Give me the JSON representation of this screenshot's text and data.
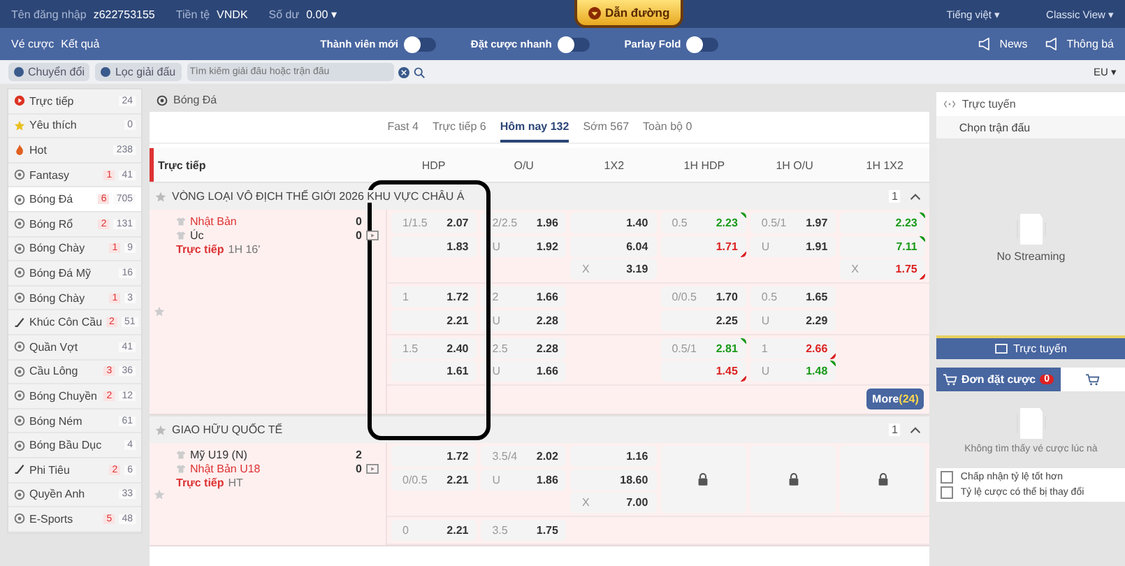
{
  "account": {
    "fields": [
      {
        "label": "Tên đăng nhập",
        "value": "z622753155"
      },
      {
        "label": "Tiền tệ",
        "value": "VNDK"
      },
      {
        "label": "Số dư",
        "value": "0.00 ▾"
      }
    ],
    "guide_tab": "Dẫn đường",
    "language": "Tiếng việt ▾",
    "view": "Classic View ▾"
  },
  "nav": {
    "links": [
      "Vé cược",
      "Kết quả"
    ],
    "toggles": [
      {
        "label": "Thành viên mới",
        "on": false
      },
      {
        "label": "Đặt cược nhanh",
        "on": false
      },
      {
        "label": "Parlay Fold",
        "on": false
      }
    ],
    "right_links": [
      "News",
      "Thông bá"
    ]
  },
  "filter_bar": {
    "buttons": [
      "Chuyển đổi",
      "Lọc giải đấu"
    ],
    "search": {
      "placeholder": "Tìm kiếm giải đấu hoặc trận đấu"
    },
    "odds_format": "EU ▾"
  },
  "sidebar": {
    "items": [
      {
        "kind": "live",
        "name": "Trực tiếp",
        "total": "24",
        "selected": false
      },
      {
        "kind": "star",
        "name": "Yêu thích",
        "total": "0",
        "selected": false
      },
      {
        "kind": "flame",
        "name": "Hot",
        "total": "238",
        "selected": false
      },
      {
        "kind": "ball",
        "name": "Fantasy",
        "live": "1",
        "total": "41",
        "selected": false
      },
      {
        "kind": "ball",
        "name": "Bóng Đá",
        "live": "6",
        "total": "705",
        "selected": true
      },
      {
        "kind": "ball",
        "name": "Bóng Rổ",
        "live": "2",
        "total": "131",
        "selected": false
      },
      {
        "kind": "ball",
        "name": "Bóng Chày",
        "live": "1",
        "total": "9",
        "selected": false
      },
      {
        "kind": "ball",
        "name": "Bóng Đá Mỹ",
        "total": "16",
        "selected": false
      },
      {
        "kind": "ball",
        "name": "Bóng Chày",
        "live": "1",
        "total": "3",
        "selected": false
      },
      {
        "kind": "stick",
        "name": "Khúc Côn Cầu",
        "live": "2",
        "total": "51",
        "selected": false
      },
      {
        "kind": "ball",
        "name": "Quần Vợt",
        "total": "41",
        "selected": false
      },
      {
        "kind": "ball",
        "name": "Cầu Lông",
        "live": "3",
        "total": "36",
        "selected": false
      },
      {
        "kind": "ball",
        "name": "Bóng Chuyền",
        "live": "2",
        "total": "12",
        "selected": false
      },
      {
        "kind": "ball",
        "name": "Bóng Ném",
        "total": "61",
        "selected": false
      },
      {
        "kind": "ball",
        "name": "Bóng Bầu Dục",
        "total": "4",
        "selected": false
      },
      {
        "kind": "stick",
        "name": "Phi Tiêu",
        "live": "2",
        "total": "6",
        "selected": false
      },
      {
        "kind": "ball",
        "name": "Quyền Anh",
        "total": "33",
        "selected": false
      },
      {
        "kind": "ball",
        "name": "E-Sports",
        "live": "5",
        "total": "48",
        "selected": false
      }
    ]
  },
  "main": {
    "title": "Bóng Đá",
    "tabs": [
      {
        "label": "Fast 4",
        "selected": false
      },
      {
        "label": "Trực tiếp 6",
        "selected": false
      },
      {
        "label": "Hôm nay 132",
        "selected": true
      },
      {
        "label": "Sớm 567",
        "selected": false
      },
      {
        "label": "Toàn bộ 0",
        "selected": false
      }
    ],
    "section": "Trực tiếp",
    "columns": [
      "HDP",
      "O/U",
      "1X2",
      "1H HDP",
      "1H O/U",
      "1H 1X2"
    ],
    "leagues": [
      {
        "name": "VÒNG LOẠI VÔ ĐỊCH THẾ GIỚI 2026 KHU VỰC CHÂU Á",
        "count": "1",
        "more": {
          "label": "More",
          "count": "(24)"
        },
        "matches": [
          {
            "home": "Nhật Bản",
            "away": "Úc",
            "home_favored": true,
            "home_score": "0",
            "away_score": "0",
            "status": "Trực tiếp",
            "time": "1H 16'",
            "groups": [
              [
                {
                  "kind": "odds",
                  "cells": [
                    {
                      "line": "1/1.5",
                      "value": "2.07",
                      "up": false,
                      "down": false
                    },
                    {
                      "value": "1.83",
                      "up": false,
                      "down": false
                    }
                  ]
                },
                {
                  "kind": "odds",
                  "cells": [
                    {
                      "line": "2/2.5",
                      "value": "1.96",
                      "up": false,
                      "down": false
                    },
                    {
                      "line": "U",
                      "value": "1.92",
                      "up": false,
                      "down": false
                    }
                  ]
                },
                {
                  "kind": "odds",
                  "cells": [
                    {
                      "value": "1.40",
                      "up": false,
                      "down": false
                    },
                    {
                      "value": "6.04",
                      "up": false,
                      "down": false
                    },
                    {
                      "line": "X",
                      "value": "3.19",
                      "up": false,
                      "down": false
                    }
                  ]
                },
                {
                  "kind": "odds",
                  "cells": [
                    {
                      "line": "0.5",
                      "value": "2.23",
                      "up": true,
                      "down": false
                    },
                    {
                      "value": "1.71",
                      "up": false,
                      "down": true
                    }
                  ]
                },
                {
                  "kind": "odds",
                  "cells": [
                    {
                      "line": "0.5/1",
                      "value": "1.97",
                      "up": false,
                      "down": false
                    },
                    {
                      "line": "U",
                      "value": "1.91",
                      "up": false,
                      "down": false
                    }
                  ]
                },
                {
                  "kind": "odds",
                  "cells": [
                    {
                      "value": "2.23",
                      "up": true,
                      "down": false
                    },
                    {
                      "value": "7.11",
                      "up": true,
                      "down": false
                    },
                    {
                      "line": "X",
                      "value": "1.75",
                      "up": false,
                      "down": true
                    }
                  ]
                }
              ],
              [
                {
                  "kind": "odds",
                  "cells": [
                    {
                      "line": "1",
                      "value": "1.72",
                      "up": false,
                      "down": false
                    },
                    {
                      "value": "2.21",
                      "up": false,
                      "down": false
                    }
                  ]
                },
                {
                  "kind": "odds",
                  "cells": [
                    {
                      "line": "2",
                      "value": "1.66",
                      "up": false,
                      "down": false
                    },
                    {
                      "line": "U",
                      "value": "2.28",
                      "up": false,
                      "down": false
                    }
                  ]
                },
                {
                  "kind": "empty"
                },
                {
                  "kind": "odds",
                  "cells": [
                    {
                      "line": "0/0.5",
                      "value": "1.70",
                      "up": false,
                      "down": false
                    },
                    {
                      "value": "2.25",
                      "up": false,
                      "down": false
                    }
                  ]
                },
                {
                  "kind": "odds",
                  "cells": [
                    {
                      "line": "0.5",
                      "value": "1.65",
                      "up": false,
                      "down": false
                    },
                    {
                      "line": "U",
                      "value": "2.29",
                      "up": false,
                      "down": false
                    }
                  ]
                },
                {
                  "kind": "empty"
                }
              ],
              [
                {
                  "kind": "odds",
                  "cells": [
                    {
                      "line": "1.5",
                      "value": "2.40",
                      "up": false,
                      "down": false
                    },
                    {
                      "value": "1.61",
                      "up": false,
                      "down": false
                    }
                  ]
                },
                {
                  "kind": "odds",
                  "cells": [
                    {
                      "line": "2.5",
                      "value": "2.28",
                      "up": false,
                      "down": false
                    },
                    {
                      "line": "U",
                      "value": "1.66",
                      "up": false,
                      "down": false
                    }
                  ]
                },
                {
                  "kind": "empty"
                },
                {
                  "kind": "odds",
                  "cells": [
                    {
                      "line": "0.5/1",
                      "value": "2.81",
                      "up": true,
                      "down": false
                    },
                    {
                      "value": "1.45",
                      "up": false,
                      "down": true
                    }
                  ]
                },
                {
                  "kind": "odds",
                  "cells": [
                    {
                      "line": "1",
                      "value": "2.66",
                      "up": false,
                      "down": true
                    },
                    {
                      "line": "U",
                      "value": "1.48",
                      "up": true,
                      "down": false
                    }
                  ]
                },
                {
                  "kind": "empty"
                }
              ]
            ]
          }
        ]
      },
      {
        "name": "GIAO HỮU QUỐC TẾ",
        "count": "1",
        "matches": [
          {
            "home": "Mỹ U19 (N)",
            "away": "Nhật Bản U18",
            "home_favored": false,
            "home_score": "2",
            "away_score": "0",
            "status": "Trực tiếp",
            "time": "HT",
            "groups": [
              [
                {
                  "kind": "odds",
                  "cells": [
                    {
                      "value": "1.72",
                      "up": false,
                      "down": false
                    },
                    {
                      "line": "0/0.5",
                      "value": "2.21",
                      "up": false,
                      "down": false
                    }
                  ]
                },
                {
                  "kind": "odds",
                  "cells": [
                    {
                      "line": "3.5/4",
                      "value": "2.02",
                      "up": false,
                      "down": false
                    },
                    {
                      "line": "U",
                      "value": "1.86",
                      "up": false,
                      "down": false
                    }
                  ]
                },
                {
                  "kind": "odds",
                  "cells": [
                    {
                      "value": "1.16",
                      "up": false,
                      "down": false
                    },
                    {
                      "value": "18.60",
                      "up": false,
                      "down": false
                    },
                    {
                      "line": "X",
                      "value": "7.00",
                      "up": false,
                      "down": false
                    }
                  ]
                },
                {
                  "kind": "locked"
                },
                {
                  "kind": "locked"
                },
                {
                  "kind": "locked"
                }
              ],
              [
                {
                  "kind": "odds",
                  "cells": [
                    {
                      "line": "0",
                      "value": "2.21",
                      "up": false,
                      "down": false
                    }
                  ]
                },
                {
                  "kind": "odds",
                  "cells": [
                    {
                      "line": "3.5",
                      "value": "1.75",
                      "up": false,
                      "down": false
                    }
                  ]
                },
                {
                  "kind": "empty"
                },
                {
                  "kind": "empty"
                },
                {
                  "kind": "empty"
                },
                {
                  "kind": "empty"
                }
              ]
            ]
          }
        ]
      }
    ]
  },
  "stream_panel": {
    "title": "Trực tuyến",
    "select": "Chọn trận đấu",
    "empty": "No Streaming",
    "button": "Trực tuyến"
  },
  "bet_slip": {
    "tabs": [
      {
        "label": "Đơn đặt cược",
        "badge": "0",
        "selected": true
      },
      {
        "selected": false
      }
    ],
    "empty": "Không tìm thấy vé cược lúc nà",
    "options": [
      {
        "label": "Chấp nhận tỷ lệ tốt hơn",
        "checked": false
      },
      {
        "label": "Tỷ lệ cược có thể bị thay đổi",
        "checked": false
      }
    ]
  }
}
